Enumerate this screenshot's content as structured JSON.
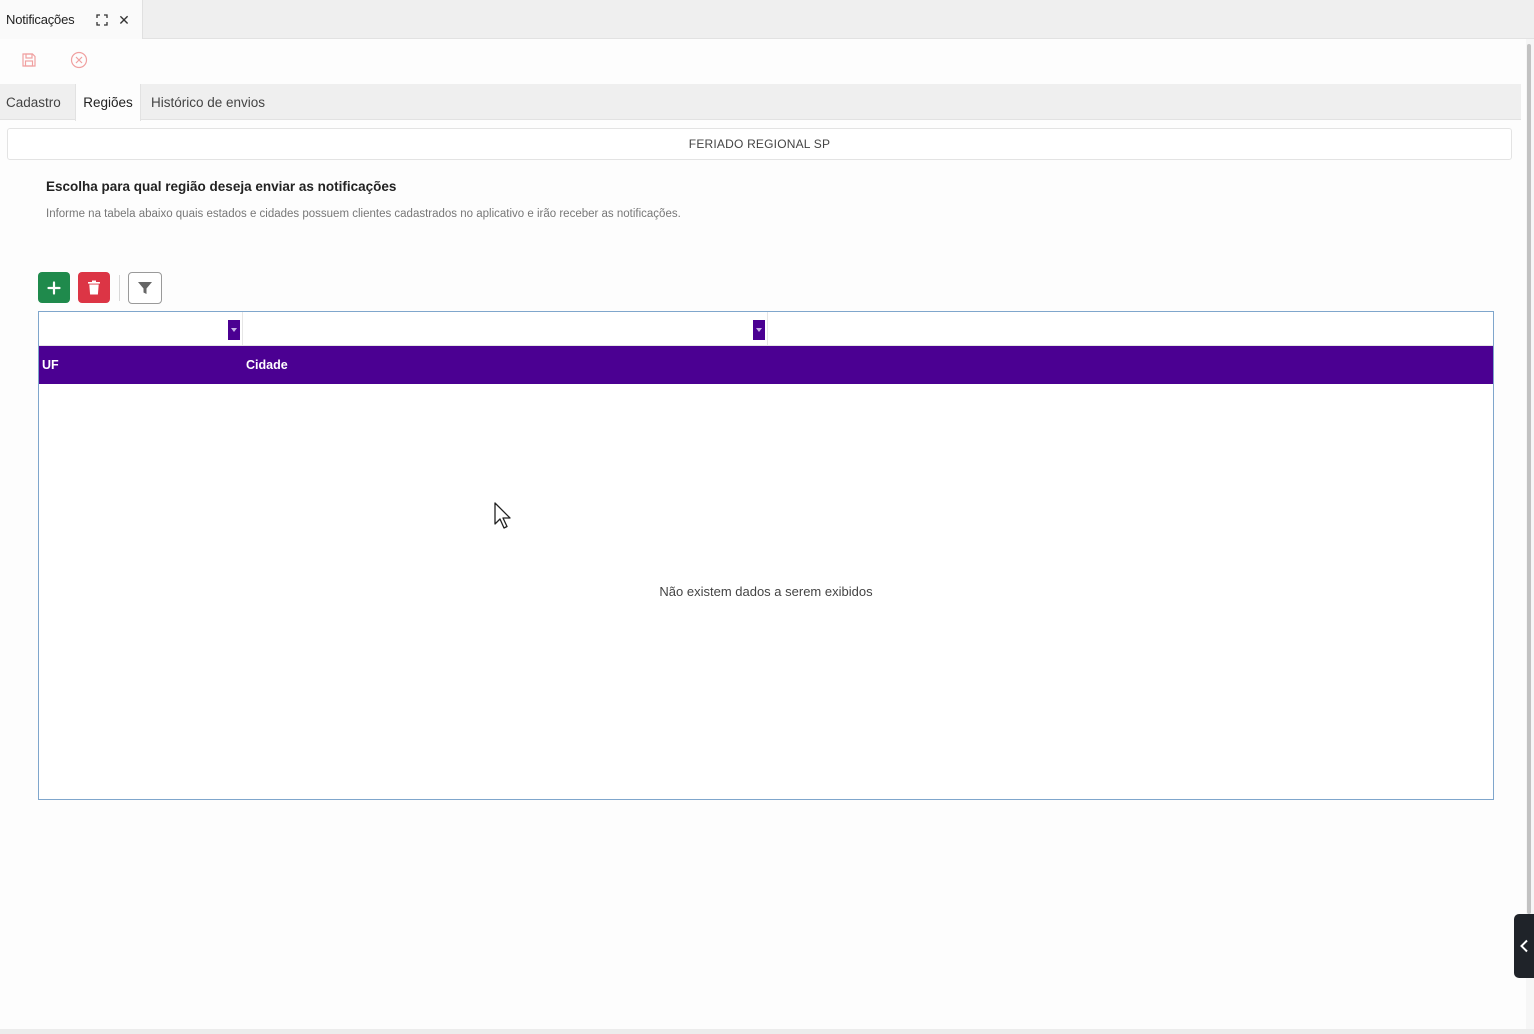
{
  "window_tab": {
    "title": "Notificações",
    "close_glyph": "✕"
  },
  "toolbar": {
    "save_icon": "save-icon",
    "cancel_icon": "cancel-icon",
    "icon_color": "#f0a0a0"
  },
  "tabs": [
    {
      "label": "Cadastro",
      "active": false
    },
    {
      "label": "Regiões",
      "active": true
    },
    {
      "label": "Histórico de envios",
      "active": false
    }
  ],
  "record": {
    "title": "FERIADO REGIONAL SP"
  },
  "section": {
    "title": "Escolha para qual região deseja enviar as notificações",
    "description": "Informe na tabela abaixo quais estados e cidades possuem clientes cadastrados no aplicativo e irão receber as notificações."
  },
  "grid": {
    "buttons": {
      "add_icon": "plus-icon",
      "delete_icon": "trash-icon",
      "filter_icon": "filter-icon"
    },
    "columns": [
      {
        "key": "uf",
        "label": "UF"
      },
      {
        "key": "cidade",
        "label": "Cidade"
      }
    ],
    "rows": [],
    "empty_message": "Não existem dados a serem exibidos",
    "header_color": "#4b0092",
    "add_color": "#1f8a4c",
    "delete_color": "#dc3545"
  }
}
